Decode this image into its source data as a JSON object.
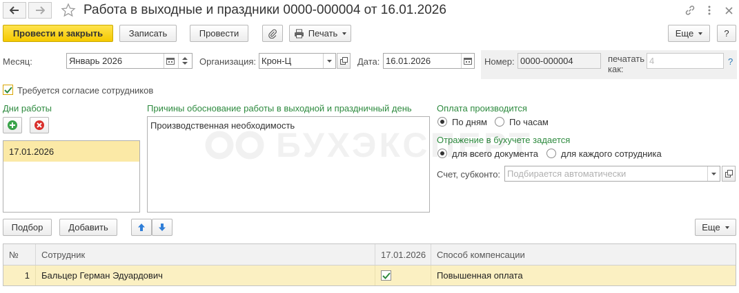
{
  "window": {
    "title": "Работа в выходные и праздники 0000-000004 от 16.01.2026"
  },
  "toolbar": {
    "post_close_label": "Провести и закрыть",
    "save_label": "Записать",
    "post_label": "Провести",
    "print_label": "Печать",
    "more_label": "Еще",
    "help_label": "?"
  },
  "header": {
    "month_label": "Месяц:",
    "month_value": "Январь 2026",
    "org_label": "Организация:",
    "org_value": "Крон-Ц",
    "date_label": "Дата:",
    "date_value": "16.01.2026",
    "number_label": "Номер:",
    "number_value": "0000-000004",
    "print_as_label_1": "печатать",
    "print_as_label_2": "как:",
    "print_as_value": "4",
    "help_mark": "?"
  },
  "consent": {
    "label": "Требуется согласие сотрудников",
    "checked": true
  },
  "work_days": {
    "title": "Дни работы",
    "items": [
      "17.01.2026"
    ]
  },
  "reasons": {
    "title": "Причины обоснование работы в выходной и праздничный день",
    "text": "Производственная необходимость"
  },
  "payment": {
    "title": "Оплата производится",
    "options": [
      {
        "label": "По дням",
        "selected": true
      },
      {
        "label": "По часам",
        "selected": false
      }
    ]
  },
  "accounting": {
    "title": "Отражение в бухучете задается",
    "options": [
      {
        "label": "для всего документа",
        "selected": true
      },
      {
        "label": "для каждого сотрудника",
        "selected": false
      }
    ],
    "account_label": "Счет, субконто:",
    "account_placeholder": "Подбирается автоматически"
  },
  "table_toolbar": {
    "select_label": "Подбор",
    "add_label": "Добавить",
    "more_label": "Еще"
  },
  "table": {
    "columns": [
      "№",
      "Сотрудник",
      "17.01.2026",
      "Способ компенсации"
    ],
    "rows": [
      {
        "num": "1",
        "employee": "Бальцер Герман Эдуардович",
        "checked": true,
        "compensation": "Повышенная оплата"
      }
    ]
  },
  "watermark": "БУХЭКСПЕРТ",
  "colors": {
    "accent_yellow": "#f5c900",
    "section_green": "#2d8a3e",
    "selected_row": "#fbf0c2"
  }
}
